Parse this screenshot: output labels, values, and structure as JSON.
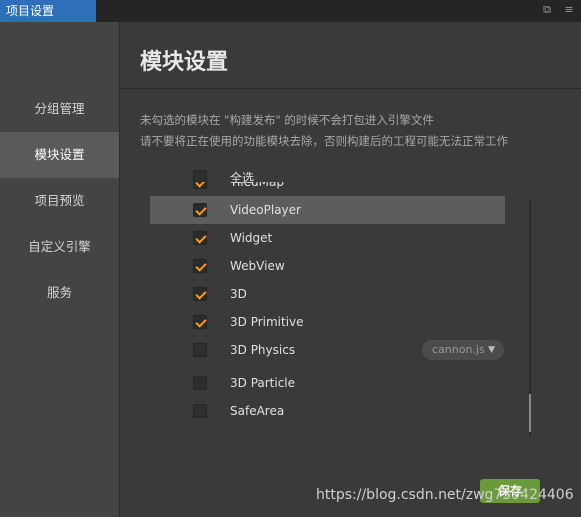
{
  "window": {
    "title": "项目设置",
    "restore_icon": "restore-icon",
    "menu_icon": "menu-icon"
  },
  "sidebar": {
    "items": [
      {
        "label": "分组管理"
      },
      {
        "label": "模块设置",
        "active": true
      },
      {
        "label": "项目预览"
      },
      {
        "label": "自定义引擎"
      },
      {
        "label": "服务"
      }
    ]
  },
  "main": {
    "heading": "模块设置",
    "desc_line1": "未勾选的模块在 \"构建发布\" 的时候不会打包进入引擎文件",
    "desc_line2": "请不要将正在使用的功能模块去除，否则构建后的工程可能无法正常工作",
    "select_all": {
      "label": "全选",
      "checked": false
    },
    "modules": [
      {
        "label": "TiledMap",
        "checked": true
      },
      {
        "label": "VideoPlayer",
        "checked": true,
        "selected": true
      },
      {
        "label": "Widget",
        "checked": true
      },
      {
        "label": "WebView",
        "checked": true
      },
      {
        "label": "3D",
        "checked": true
      },
      {
        "label": "3D Primitive",
        "checked": true
      },
      {
        "label": "3D Physics",
        "checked": false,
        "engine": "cannon.js"
      },
      {
        "label": "3D Particle",
        "checked": false
      },
      {
        "label": "SafeArea",
        "checked": false
      }
    ],
    "save_label": "保存"
  },
  "watermark": "https://blog.csdn.net/zwg739424406",
  "colors": {
    "accent": "#2d6fb8",
    "check": "#ff9a1a",
    "save": "#6a9a3a"
  }
}
